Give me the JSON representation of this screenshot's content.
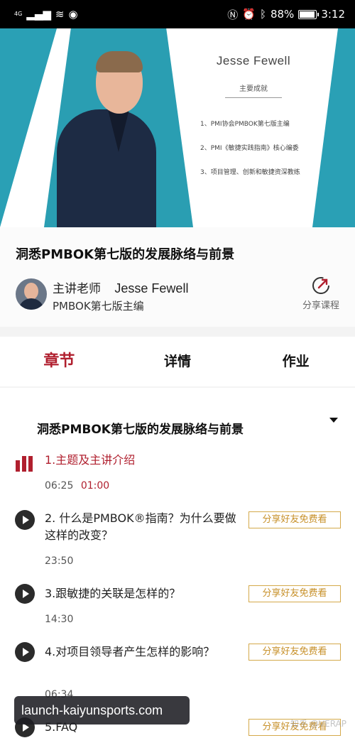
{
  "status_bar": {
    "network": "4G",
    "battery": "88%",
    "time": "3:12"
  },
  "banner": {
    "name": "Jesse Fewell",
    "subtitle": "主要成就",
    "achievements": [
      "1、PMI协会PMBOK第七版主编",
      "2、PMI《敏捷实践指南》核心编委",
      "3、项目管理、创新和敏捷资深教练"
    ]
  },
  "course": {
    "title": "洞悉PMBOK第七版的发展脉络与前景",
    "teacher_label": "主讲老师",
    "teacher_name": "Jesse Fewell",
    "teacher_role": "PMBOK第七版主编",
    "share_label": "分享课程"
  },
  "tabs": [
    {
      "label": "章节",
      "active": true
    },
    {
      "label": "详情",
      "active": false
    },
    {
      "label": "作业",
      "active": false
    }
  ],
  "chapter": {
    "section_title": "洞悉PMBOK第七版的发展脉络与前景",
    "lessons": [
      {
        "title": "1.主题及主讲介绍",
        "duration": "06:25",
        "progress": "01:00",
        "playing": true
      },
      {
        "title": "2. 什么是PMBOK®指南？为什么要做这样的改变？",
        "duration": "23:50",
        "button": "分享好友免费看"
      },
      {
        "title": "3.跟敏捷的关联是怎样的？",
        "duration": "14:30",
        "button": "分享好友免费看"
      },
      {
        "title": "4.对项目领导者产生怎样的影响？",
        "duration": "06:34",
        "button": "分享好友免费看"
      },
      {
        "title": "5.FAQ",
        "button": "分享好友免费看"
      }
    ]
  },
  "watermark": "知乎 @VERAP",
  "overlay_url": "launch-kaiyunsports.com",
  "colors": {
    "accent": "#b01f2e",
    "teal": "#2aa0b5",
    "gold": "#c79029"
  }
}
